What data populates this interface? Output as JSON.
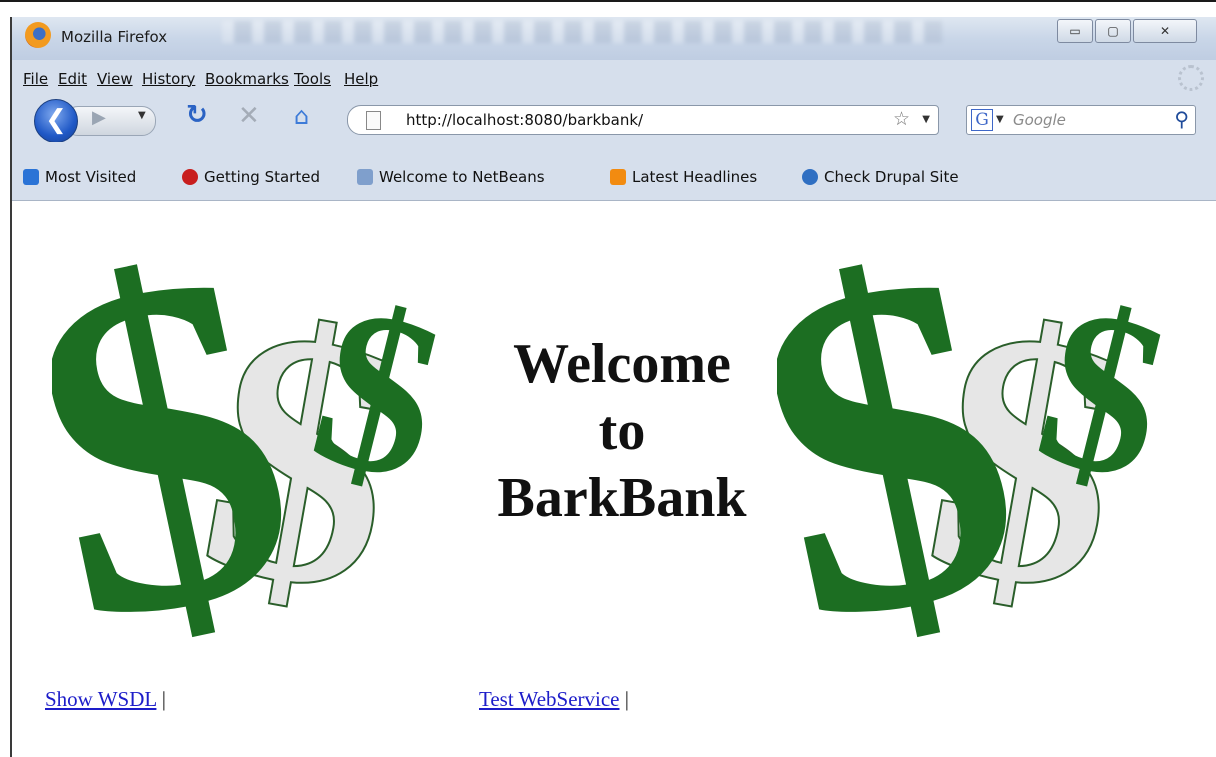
{
  "window": {
    "title": "Mozilla Firefox",
    "controls": {
      "minimize": "▭",
      "maximize": "▢",
      "close": "✕"
    }
  },
  "menubar": {
    "items": [
      "File",
      "Edit",
      "View",
      "History",
      "Bookmarks",
      "Tools",
      "Help"
    ]
  },
  "navbar": {
    "url": "http://localhost:8080/barkbank/",
    "search_placeholder": "Google",
    "search_engine_letter": "G"
  },
  "bookmarks": [
    {
      "label": "Most Visited",
      "icon": "magnifier-icon",
      "color": "#2a73d6"
    },
    {
      "label": "Getting Started",
      "icon": "firefox-red-icon",
      "color": "#c81e1e"
    },
    {
      "label": "Welcome to NetBeans",
      "icon": "netbeans-icon",
      "color": "#7f9fcc"
    },
    {
      "label": "Latest Headlines",
      "icon": "rss-icon",
      "color": "#f28b10"
    },
    {
      "label": "Check Drupal Site",
      "icon": "drupal-icon",
      "color": "#2f6fc2"
    }
  ],
  "page": {
    "heading": [
      "Welcome",
      "to",
      "BarkBank"
    ],
    "links": [
      {
        "label": "Show WSDL",
        "separator": "|"
      },
      {
        "label": "Test WebService",
        "separator": "|"
      }
    ]
  },
  "colors": {
    "dollar_green": "#1c6e22",
    "dollar_gray": "#e6e6e6",
    "link": "#1d1dc9"
  }
}
